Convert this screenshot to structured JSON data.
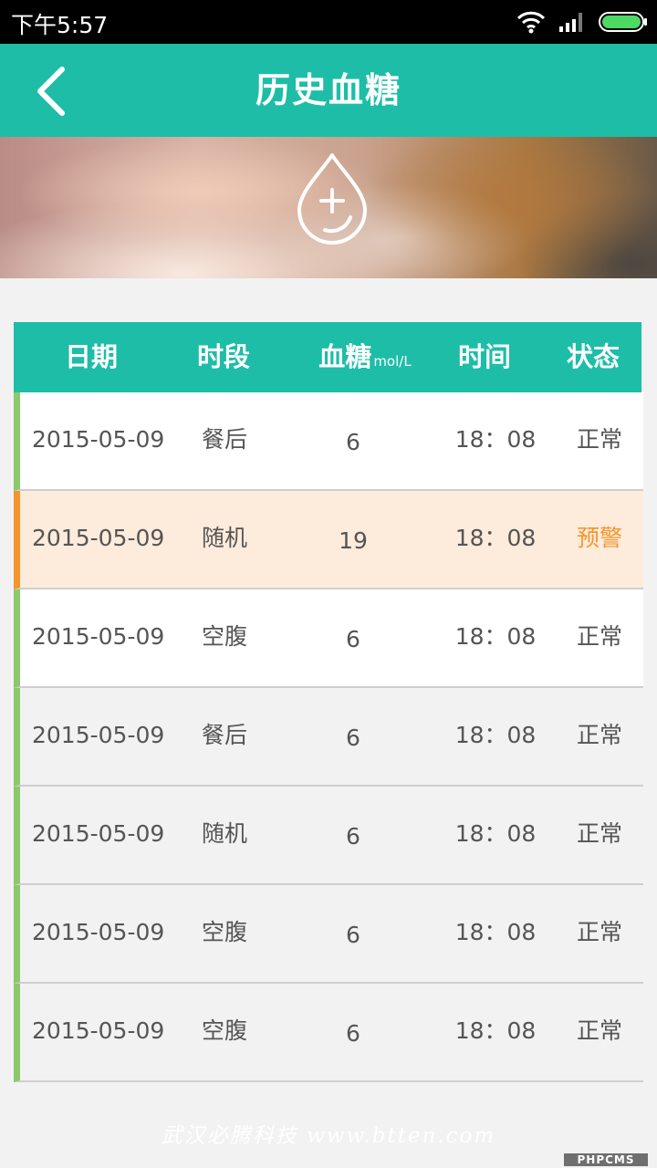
{
  "status_bar": {
    "time": "下午5:57",
    "icons": [
      "wifi-icon",
      "signal-icon",
      "battery-icon"
    ]
  },
  "header": {
    "title": "历史血糖",
    "back_icon": "chevron-left-icon"
  },
  "banner": {
    "add_icon": "blood-drop-plus-icon"
  },
  "table": {
    "headers": {
      "date": "日期",
      "period": "时段",
      "glucose": "血糖",
      "glucose_unit": "mol/L",
      "time": "时间",
      "status": "状态"
    },
    "rows": [
      {
        "date": "2015-05-09",
        "period": "餐后",
        "value": "6",
        "time": "18：08",
        "status": "正常"
      },
      {
        "date": "2015-05-09",
        "period": "随机",
        "value": "19",
        "time": "18：08",
        "status": "预警"
      },
      {
        "date": "2015-05-09",
        "period": "空腹",
        "value": "6",
        "time": "18：08",
        "status": "正常"
      },
      {
        "date": "2015-05-09",
        "period": "餐后",
        "value": "6",
        "time": "18：08",
        "status": "正常"
      },
      {
        "date": "2015-05-09",
        "period": "随机",
        "value": "6",
        "time": "18：08",
        "status": "正常"
      },
      {
        "date": "2015-05-09",
        "period": "空腹",
        "value": "6",
        "time": "18：08",
        "status": "正常"
      },
      {
        "date": "2015-05-09",
        "period": "空腹",
        "value": "6",
        "time": "18：08",
        "status": "正常"
      }
    ]
  },
  "footer": {
    "watermark": "武汉必腾科技 www.btten.com",
    "badge": "PHPCMS"
  },
  "colors": {
    "primary": "#1ebda7",
    "normal_marker": "#8cc96d",
    "warning": "#f6952c",
    "warning_bg": "#fdecdc"
  }
}
